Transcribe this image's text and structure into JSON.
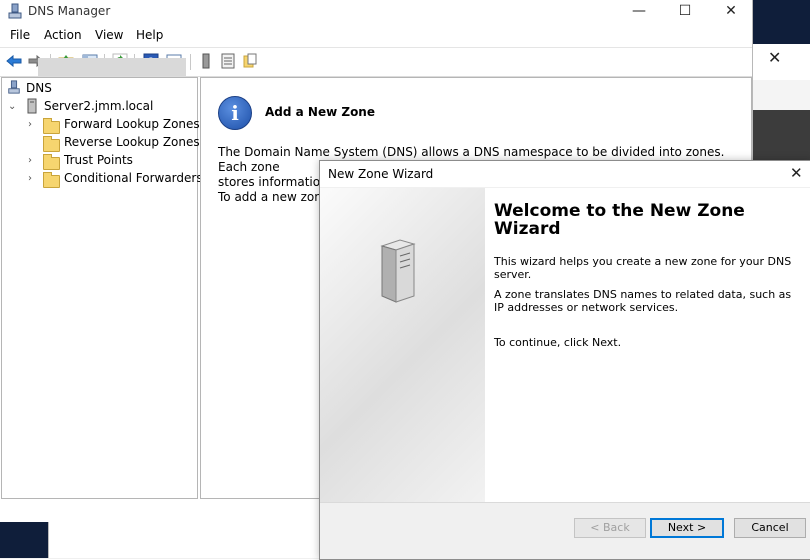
{
  "window": {
    "title": "DNS Manager"
  },
  "menu": [
    "File",
    "Action",
    "View",
    "Help"
  ],
  "tree": {
    "root": "DNS",
    "server": "Server2.jmm.local",
    "items": [
      {
        "label": "Forward Lookup Zones",
        "selected": false
      },
      {
        "label": "Reverse Lookup Zones",
        "selected": true
      },
      {
        "label": "Trust Points",
        "selected": false
      },
      {
        "label": "Conditional Forwarders",
        "selected": false
      }
    ]
  },
  "content": {
    "title": "Add a New Zone",
    "description_line1": "The Domain Name System (DNS) allows a DNS namespace to be divided into zones. Each zone",
    "description_line2": "stores information a",
    "instruction": "To add a new zone,"
  },
  "wizard": {
    "title": "New Zone Wizard",
    "heading": "Welcome to the New Zone Wizard",
    "paragraph1": "This wizard helps you create a new zone for your DNS server.",
    "paragraph2": "A zone translates DNS names to related data, such as IP addresses or network services.",
    "paragraph3": "To continue, click Next.",
    "buttons": {
      "back": "< Back",
      "next": "Next >",
      "cancel": "Cancel"
    }
  },
  "icons": {
    "back": "back-arrow-icon",
    "forward": "forward-arrow-icon",
    "info": "info-icon",
    "server": "server-icon"
  },
  "colors": {
    "accent": "#0078d7",
    "selection": "#d9d9d9",
    "info_blue": "#1d4fa8"
  }
}
